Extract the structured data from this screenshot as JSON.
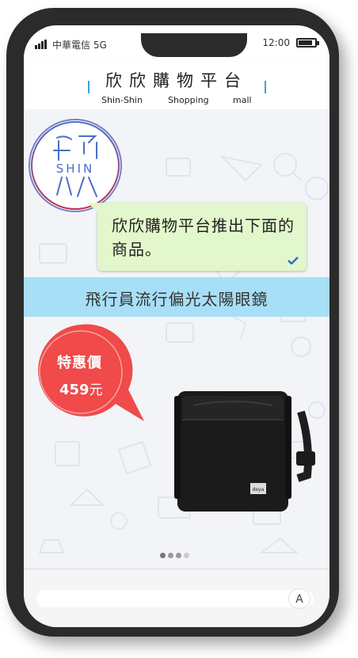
{
  "status_bar": {
    "carrier": "中華電信 5G",
    "time": "12:00",
    "battery_level": 0.85
  },
  "header": {
    "title": "欣欣購物平台",
    "subtitle_parts": [
      "Shin-Shin",
      "Shopping",
      "mall"
    ]
  },
  "chat": {
    "avatar_logo_text": "SHIN",
    "message": "欣欣購物平台推出下面的商品。",
    "read_icon": "check-icon"
  },
  "product": {
    "banner_title": "飛行員流行偏光太陽眼鏡",
    "price_label": "特惠價",
    "price_value": "459",
    "price_unit": "元",
    "image_icon": "shoulder-bag-icon",
    "brand_tag": "deya"
  },
  "carousel": {
    "total": 4,
    "active_index": 0
  },
  "input_bar": {
    "font_button_label": "A"
  },
  "colors": {
    "bubble": "#e2f7cb",
    "banner": "#a7dff7",
    "price_badge": "#f04a4a",
    "check": "#2c6fc4"
  }
}
